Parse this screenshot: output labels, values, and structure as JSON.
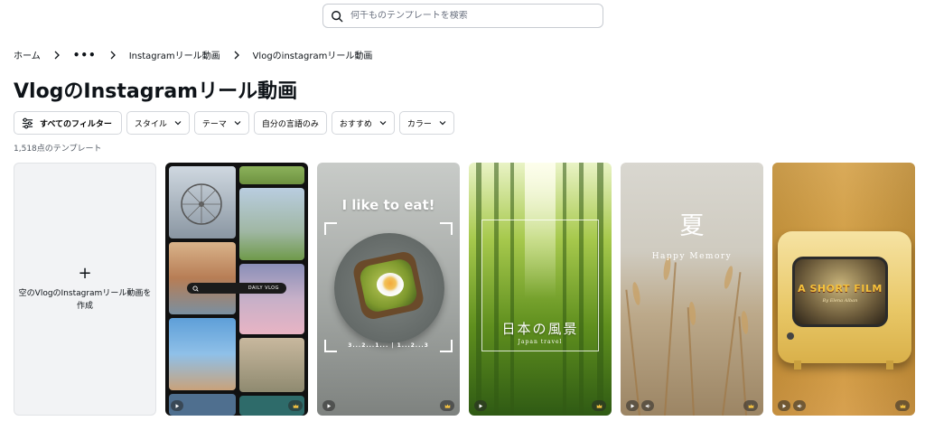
{
  "search": {
    "placeholder": "何千ものテンプレートを検索"
  },
  "breadcrumb": {
    "home": "ホーム",
    "more": "•••",
    "parent": "Instagramリール動画",
    "current": "Vlogのinstagramリール動画"
  },
  "page": {
    "title": "VlogのInstagramリール動画",
    "count": "1,518点のテンプレート"
  },
  "filters": {
    "all": "すべてのフィルター",
    "style": "スタイル",
    "theme": "テーマ",
    "language": "自分の言語のみ",
    "recommended": "おすすめ",
    "color": "カラー"
  },
  "blank_card": {
    "plus": "+",
    "label": "空のVlogのInstagramリール動画を作成"
  },
  "templates": [
    {
      "overlay": "DAILY VLOG",
      "badges": [
        "play-icon",
        "crown-icon"
      ]
    },
    {
      "headline": "I like to eat!",
      "counter": "3...2...1...",
      "counter2": "1...2...3",
      "badges": [
        "play-icon",
        "crown-icon"
      ]
    },
    {
      "title": "日本の風景",
      "subtitle": "Japan travel",
      "badges": [
        "play-icon",
        "crown-icon"
      ]
    },
    {
      "title": "夏",
      "subtitle": "Happy Memory",
      "badges": [
        "play-icon",
        "sound-icon",
        "crown-icon"
      ]
    },
    {
      "title": "A SHORT FILM",
      "subtitle": "By Elena Alban",
      "badges": [
        "play-icon",
        "sound-icon",
        "crown-icon"
      ]
    }
  ],
  "colors": {
    "text": "#0e1318",
    "border": "#d4d7dc",
    "muted": "#555c66"
  }
}
